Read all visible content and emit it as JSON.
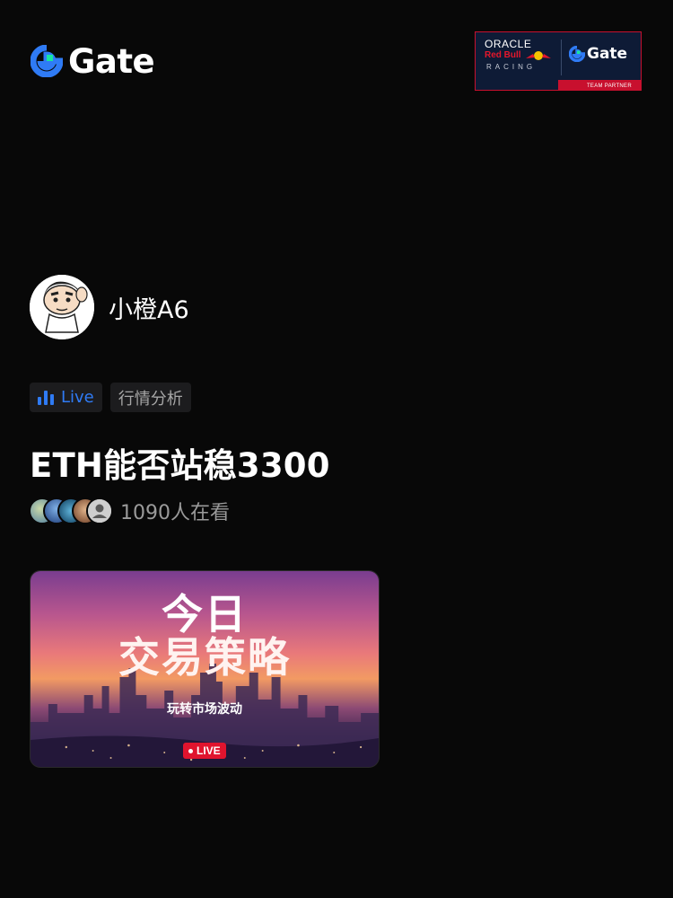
{
  "header": {
    "brand": "Gate",
    "partner": {
      "oracle": "ORACLE",
      "redbull": "Red Bull",
      "racing": "RACING",
      "brand": "Gate",
      "tagline": "TEAM PARTNER"
    }
  },
  "host": {
    "name": "小橙A6"
  },
  "tags": {
    "live": "Live",
    "topic": "行情分析"
  },
  "stream": {
    "title": "ETH能否站稳3300",
    "viewers": "1090人在看"
  },
  "cover": {
    "line1": "今日",
    "line2": "交易策略",
    "subtitle": "玩转市场波动",
    "live_badge": "LIVE"
  },
  "colors": {
    "background": "#080808",
    "accent_blue": "#2f7bf5",
    "live_red": "#e0142e",
    "muted_text": "#9a9a9a"
  },
  "icons": {
    "brand_logo": "gate-logo-icon",
    "live_bars": "bar-chart-icon",
    "default_viewer": "user-icon"
  }
}
